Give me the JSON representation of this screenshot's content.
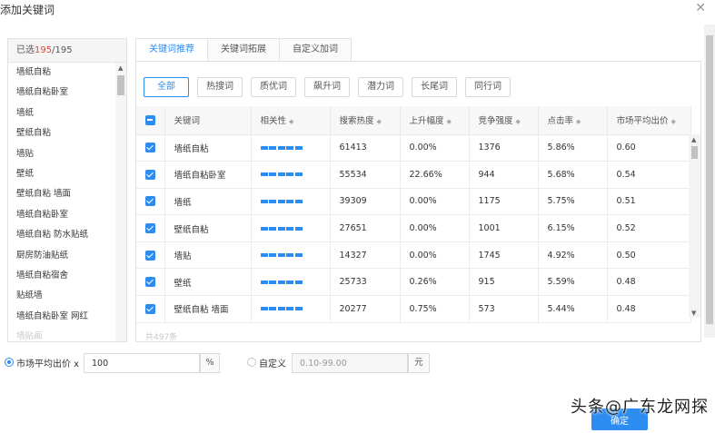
{
  "dialog": {
    "title": "添加关键词"
  },
  "selected": {
    "prefix": "已选",
    "count": "195",
    "total": "/195",
    "items": [
      "墙纸自粘",
      "墙纸自粘卧室",
      "墙纸",
      "壁纸自粘",
      "墙贴",
      "壁纸",
      "壁纸自粘 墙面",
      "墙纸自粘卧室",
      "墙纸自粘 防水贴纸",
      "厨房防油贴纸",
      "墙纸自粘宿舍",
      "贴纸墙",
      "墙纸自粘卧室 网红",
      "墙贴画"
    ]
  },
  "tabs": [
    {
      "label": "关键词推荐",
      "active": true
    },
    {
      "label": "关键词拓展",
      "active": false
    },
    {
      "label": "自定义加词",
      "active": false
    }
  ],
  "filters": [
    {
      "label": "全部",
      "active": true
    },
    {
      "label": "热搜词",
      "active": false
    },
    {
      "label": "质优词",
      "active": false
    },
    {
      "label": "飙升词",
      "active": false
    },
    {
      "label": "潜力词",
      "active": false
    },
    {
      "label": "长尾词",
      "active": false
    },
    {
      "label": "同行词",
      "active": false
    }
  ],
  "table": {
    "columns": [
      "关键词",
      "相关性",
      "搜索热度",
      "上升幅度",
      "竞争强度",
      "点击率",
      "市场平均出价"
    ],
    "rows": [
      {
        "keyword": "墙纸自粘",
        "relevance": 5,
        "search": "61413",
        "rise": "0.00%",
        "competition": "1376",
        "ctr": "5.86%",
        "bid": "0.60"
      },
      {
        "keyword": "墙纸自粘卧室",
        "relevance": 5,
        "search": "55534",
        "rise": "22.66%",
        "competition": "944",
        "ctr": "5.68%",
        "bid": "0.54"
      },
      {
        "keyword": "墙纸",
        "relevance": 5,
        "search": "39309",
        "rise": "0.00%",
        "competition": "1175",
        "ctr": "5.75%",
        "bid": "0.51"
      },
      {
        "keyword": "壁纸自粘",
        "relevance": 5,
        "search": "27651",
        "rise": "0.00%",
        "competition": "1001",
        "ctr": "6.15%",
        "bid": "0.52"
      },
      {
        "keyword": "墙贴",
        "relevance": 5,
        "search": "14327",
        "rise": "0.00%",
        "competition": "1745",
        "ctr": "4.92%",
        "bid": "0.50"
      },
      {
        "keyword": "壁纸",
        "relevance": 5,
        "search": "25733",
        "rise": "0.26%",
        "competition": "915",
        "ctr": "5.59%",
        "bid": "0.48"
      },
      {
        "keyword": "壁纸自粘 墙面",
        "relevance": 5,
        "search": "20277",
        "rise": "0.75%",
        "competition": "573",
        "ctr": "5.44%",
        "bid": "0.48"
      }
    ],
    "total_text": "共497条"
  },
  "bid": {
    "market_label": "市场平均出价 x",
    "market_value": "100",
    "percent_unit": "%",
    "custom_label": "自定义",
    "custom_placeholder": "0.10-99.00",
    "yuan_unit": "元"
  },
  "footer": {
    "ok_label": "确定"
  },
  "watermark": "头条@广东龙网探",
  "colors": {
    "accent": "#2d8cf0",
    "count_red": "#f04134"
  }
}
